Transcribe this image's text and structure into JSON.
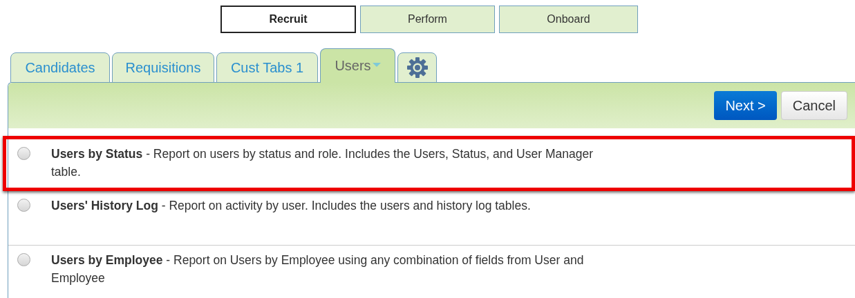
{
  "modules": [
    {
      "label": "Recruit",
      "selected": true
    },
    {
      "label": "Perform",
      "selected": false
    },
    {
      "label": "Onboard",
      "selected": false
    }
  ],
  "tabs": [
    {
      "label": "Candidates",
      "selected": false,
      "dropdown": false
    },
    {
      "label": "Requisitions",
      "selected": false,
      "dropdown": false
    },
    {
      "label": "Cust Tabs 1",
      "selected": false,
      "dropdown": false
    },
    {
      "label": "Users",
      "selected": true,
      "dropdown": true
    }
  ],
  "toolbar": {
    "buttons": [
      {
        "label": "Next >",
        "kind": "primary"
      },
      {
        "label": "Cancel",
        "kind": "secondary"
      }
    ]
  },
  "reports": [
    {
      "text": "**Users by Status** - Report on users by status and role. Includes the Users, Status, and User Manager table.",
      "selected": false,
      "highlighted": true
    },
    {
      "text": "**Users' History Log** - Report on activity by user. Includes the users and history log tables.",
      "selected": false,
      "highlighted": false
    },
    {
      "text": "**Users by Employee** - Report on Users by Employee using any combination of fields from User and Employee",
      "selected": false,
      "highlighted": false
    }
  ]
}
